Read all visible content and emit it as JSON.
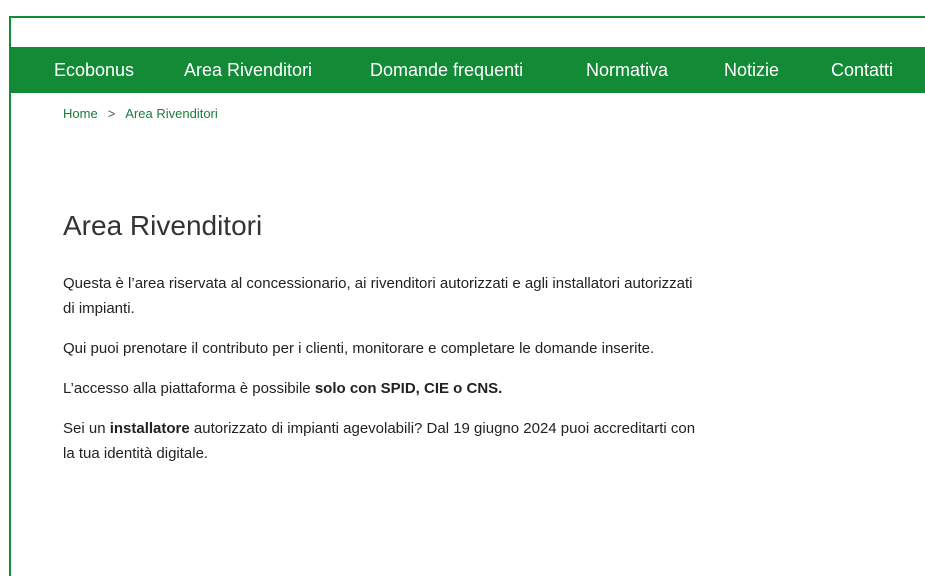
{
  "nav": {
    "items": [
      {
        "label": "Ecobonus"
      },
      {
        "label": "Area Rivenditori"
      },
      {
        "label": "Domande frequenti"
      },
      {
        "label": "Normativa"
      },
      {
        "label": "Notizie"
      },
      {
        "label": "Contatti"
      }
    ]
  },
  "breadcrumb": {
    "home": "Home",
    "separator": ">",
    "current": "Area Rivenditori"
  },
  "page": {
    "title": "Area Rivenditori",
    "p1": "Questa è l’area riservata al concessionario, ai rivenditori autorizzati e agli installatori autorizzati di impianti.",
    "p2": "Qui puoi prenotare il contributo per i clienti, monitorare e completare le domande inserite.",
    "p3_before": "L’accesso alla piattaforma è possibile ",
    "p3_bold": "solo con SPID, CIE o CNS.",
    "p4_before": "Sei un ",
    "p4_bold": "installatore",
    "p4_after": " autorizzato di impianti agevolabili? Dal 19 giugno 2024 puoi accreditarti con la tua identità digitale."
  },
  "colors": {
    "brand_green": "#138a36",
    "link_green": "#1c7a3a"
  }
}
